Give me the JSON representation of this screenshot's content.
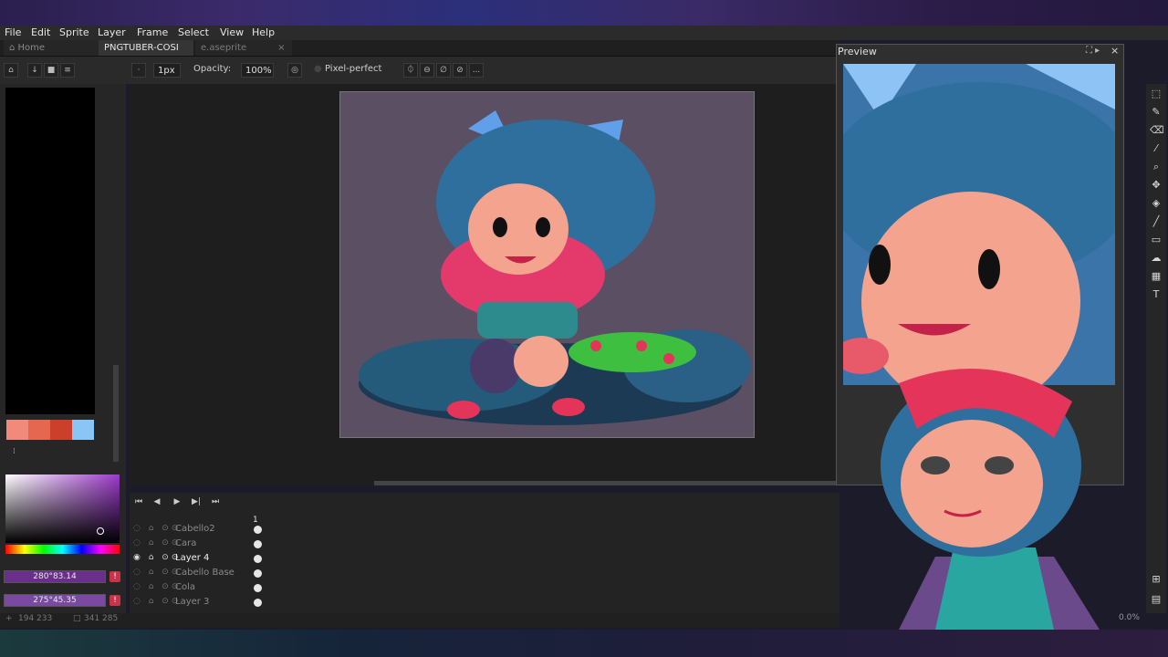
{
  "menu": [
    "File",
    "Edit",
    "Sprite",
    "Layer",
    "Frame",
    "Select",
    "View",
    "Help"
  ],
  "tabs": {
    "home": "Home",
    "active": "PNGTUBER-COSI",
    "other": "e.aseprite"
  },
  "context": {
    "brush_size": "1px",
    "opacity_label": "Opacity:",
    "opacity_value": "100%",
    "pixel_perfect": "Pixel-perfect",
    "more": "..."
  },
  "colors": {
    "palette": [
      "#f28a7b",
      "#e6674f",
      "#cc3f2a",
      "#8ac6f5"
    ],
    "primary_value": "280°83.14",
    "secondary_value": "275°45.35",
    "primary_swatch": "#6a2f8a",
    "secondary_swatch": "#7a4aa0"
  },
  "timeline": {
    "frame_number": "1",
    "layers": [
      {
        "name": "Cabello2",
        "active": false
      },
      {
        "name": "Cara",
        "active": false
      },
      {
        "name": "Layer 4",
        "active": true
      },
      {
        "name": "Cabello Base",
        "active": false
      },
      {
        "name": "Cola",
        "active": false
      },
      {
        "name": "Layer 3",
        "active": false
      }
    ]
  },
  "status": {
    "coords": "194 233",
    "size": "341 285"
  },
  "preview": {
    "title": "Preview"
  },
  "zoom": "0.0%",
  "tools": [
    "marquee-icon",
    "pencil-icon",
    "eraser-icon",
    "eyedropper-icon",
    "zoom-icon",
    "move-icon",
    "fill-icon",
    "line-icon",
    "rectangle-icon",
    "smudge-icon",
    "blur-icon",
    "text-icon"
  ]
}
